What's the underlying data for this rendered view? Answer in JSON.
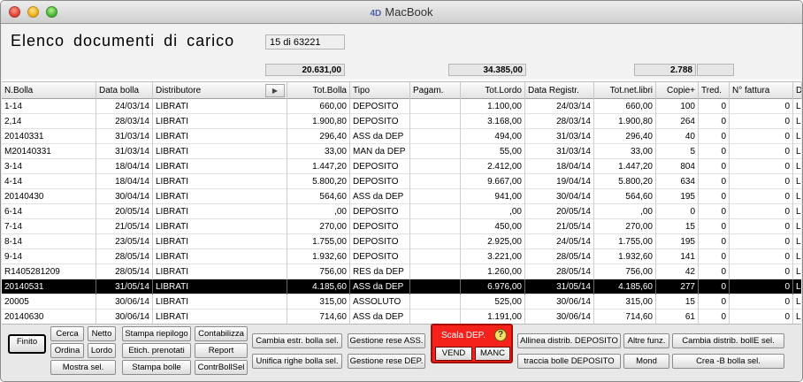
{
  "window": {
    "title": "MacBook",
    "app_badge": "4D"
  },
  "header": {
    "title": "Elenco documenti di carico",
    "counter": "15 di 63221"
  },
  "totals": {
    "tot_bolla": "20.631,00",
    "tot_lordo": "34.385,00",
    "copie": "2.788",
    "extra": ""
  },
  "columns": {
    "nbolla": "N.Bolla",
    "data_bolla": "Data bolla",
    "distributore": "Distributore",
    "arrow": "▶",
    "tot_bolla": "Tot.Bolla",
    "tipo": "Tipo",
    "pagam": "Pagam.",
    "tot_lordo": "Tot.Lordo",
    "data_registr": "Data Registr.",
    "tot_net_libri": "Tot.net.libri",
    "copie": "Copie+",
    "tred": "Tred.",
    "n_fattura": "N° fattura",
    "d": "D"
  },
  "rows": [
    {
      "nbolla": "1-14",
      "data": "24/03/14",
      "distr": "LIBRATI",
      "totbolla": "660,00",
      "tipo": "DEPOSITO",
      "pagam": "",
      "totlordo": "1.100,00",
      "dataregistr": "24/03/14",
      "netlibri": "660,00",
      "copie": "100",
      "tred": "0",
      "nfatt": "0",
      "d": "L"
    },
    {
      "nbolla": "2,14",
      "data": "28/03/14",
      "distr": "LIBRATI",
      "totbolla": "1.900,80",
      "tipo": "DEPOSITO",
      "pagam": "",
      "totlordo": "3.168,00",
      "dataregistr": "28/03/14",
      "netlibri": "1.900,80",
      "copie": "264",
      "tred": "0",
      "nfatt": "0",
      "d": "L"
    },
    {
      "nbolla": "20140331",
      "data": "31/03/14",
      "distr": "LIBRATI",
      "totbolla": "296,40",
      "tipo": "ASS da DEP",
      "pagam": "",
      "totlordo": "494,00",
      "dataregistr": "31/03/14",
      "netlibri": "296,40",
      "copie": "40",
      "tred": "0",
      "nfatt": "0",
      "d": "L"
    },
    {
      "nbolla": "M20140331",
      "data": "31/03/14",
      "distr": "LIBRATI",
      "totbolla": "33,00",
      "tipo": "MAN da DEP",
      "pagam": "",
      "totlordo": "55,00",
      "dataregistr": "31/03/14",
      "netlibri": "33,00",
      "copie": "5",
      "tred": "0",
      "nfatt": "0",
      "d": "L"
    },
    {
      "nbolla": "3-14",
      "data": "18/04/14",
      "distr": "LIBRATI",
      "totbolla": "1.447,20",
      "tipo": "DEPOSITO",
      "pagam": "",
      "totlordo": "2.412,00",
      "dataregistr": "18/04/14",
      "netlibri": "1.447,20",
      "copie": "804",
      "tred": "0",
      "nfatt": "0",
      "d": "L"
    },
    {
      "nbolla": "4-14",
      "data": "18/04/14",
      "distr": "LIBRATI",
      "totbolla": "5.800,20",
      "tipo": "DEPOSITO",
      "pagam": "",
      "totlordo": "9.667,00",
      "dataregistr": "19/04/14",
      "netlibri": "5.800,20",
      "copie": "634",
      "tred": "0",
      "nfatt": "0",
      "d": "L"
    },
    {
      "nbolla": "20140430",
      "data": "30/04/14",
      "distr": "LIBRATI",
      "totbolla": "564,60",
      "tipo": "ASS da DEP",
      "pagam": "",
      "totlordo": "941,00",
      "dataregistr": "30/04/14",
      "netlibri": "564,60",
      "copie": "195",
      "tred": "0",
      "nfatt": "0",
      "d": "L"
    },
    {
      "nbolla": "6-14",
      "data": "20/05/14",
      "distr": "LIBRATI",
      "totbolla": ",00",
      "tipo": "DEPOSITO",
      "pagam": "",
      "totlordo": ",00",
      "dataregistr": "20/05/14",
      "netlibri": ",00",
      "copie": "0",
      "tred": "0",
      "nfatt": "0",
      "d": "L"
    },
    {
      "nbolla": "7-14",
      "data": "21/05/14",
      "distr": "LIBRATI",
      "totbolla": "270,00",
      "tipo": "DEPOSITO",
      "pagam": "",
      "totlordo": "450,00",
      "dataregistr": "21/05/14",
      "netlibri": "270,00",
      "copie": "15",
      "tred": "0",
      "nfatt": "0",
      "d": "L"
    },
    {
      "nbolla": "8-14",
      "data": "23/05/14",
      "distr": "LIBRATI",
      "totbolla": "1.755,00",
      "tipo": "DEPOSITO",
      "pagam": "",
      "totlordo": "2.925,00",
      "dataregistr": "24/05/14",
      "netlibri": "1.755,00",
      "copie": "195",
      "tred": "0",
      "nfatt": "0",
      "d": "L"
    },
    {
      "nbolla": "9-14",
      "data": "28/05/14",
      "distr": "LIBRATI",
      "totbolla": "1.932,60",
      "tipo": "DEPOSITO",
      "pagam": "",
      "totlordo": "3.221,00",
      "dataregistr": "28/05/14",
      "netlibri": "1.932,60",
      "copie": "141",
      "tred": "0",
      "nfatt": "0",
      "d": "L"
    },
    {
      "nbolla": "R1405281209",
      "data": "28/05/14",
      "distr": "LIBRATI",
      "totbolla": "756,00",
      "tipo": "RES da DEP",
      "pagam": "",
      "totlordo": "1.260,00",
      "dataregistr": "28/05/14",
      "netlibri": "756,00",
      "copie": "42",
      "tred": "0",
      "nfatt": "0",
      "d": "L"
    },
    {
      "nbolla": "20140531",
      "data": "31/05/14",
      "distr": "LIBRATI",
      "totbolla": "4.185,60",
      "tipo": "ASS da DEP",
      "pagam": "",
      "totlordo": "6.976,00",
      "dataregistr": "31/05/14",
      "netlibri": "4.185,60",
      "copie": "277",
      "tred": "0",
      "nfatt": "0",
      "d": "L",
      "selected": true
    },
    {
      "nbolla": "20005",
      "data": "30/06/14",
      "distr": "LIBRATI",
      "totbolla": "315,00",
      "tipo": "ASSOLUTO",
      "pagam": "",
      "totlordo": "525,00",
      "dataregistr": "30/06/14",
      "netlibri": "315,00",
      "copie": "15",
      "tred": "0",
      "nfatt": "0",
      "d": "L"
    },
    {
      "nbolla": "20140630",
      "data": "30/06/14",
      "distr": "LIBRATI",
      "totbolla": "714,60",
      "tipo": "ASS da DEP",
      "pagam": "",
      "totlordo": "1.191,00",
      "dataregistr": "30/06/14",
      "netlibri": "714,60",
      "copie": "61",
      "tred": "0",
      "nfatt": "0",
      "d": "L"
    }
  ],
  "buttons": {
    "finito": "Finito",
    "cerca": "Cerca",
    "netto": "Netto",
    "ordina": "Ordina",
    "lordo": "Lordo",
    "mostra_sel": "Mostra sel.",
    "stampa_riepilogo": "Stampa riepilogo",
    "etich_prenotati": "Etich. prenotati",
    "stampa_bolle": "Stampa bolle",
    "contabilizza": "Contabilizza",
    "report": "Report",
    "contrbollsel": "ContrBollSel",
    "cambia_estr": "Cambia estr. bolla sel.",
    "unifica_righe": "Unifica righe bolla sel.",
    "gestione_rese_ass": "Gestione rese ASS.",
    "gestione_rese_dep": "Gestione rese DEP.",
    "scala_dep": "Scala DEP.",
    "help": "?",
    "vend": "VEND",
    "manc": "MANC",
    "allinea_distrib": "Allinea distrib. DEPOSITO",
    "traccia_bolle": "traccia bolle DEPOSITO",
    "altre_funz": "Altre funz.",
    "mond": "Mond",
    "cambia_distrib": "Cambia distrib. bollE sel.",
    "crea_b_bolla": "Crea -B bolla sel."
  }
}
